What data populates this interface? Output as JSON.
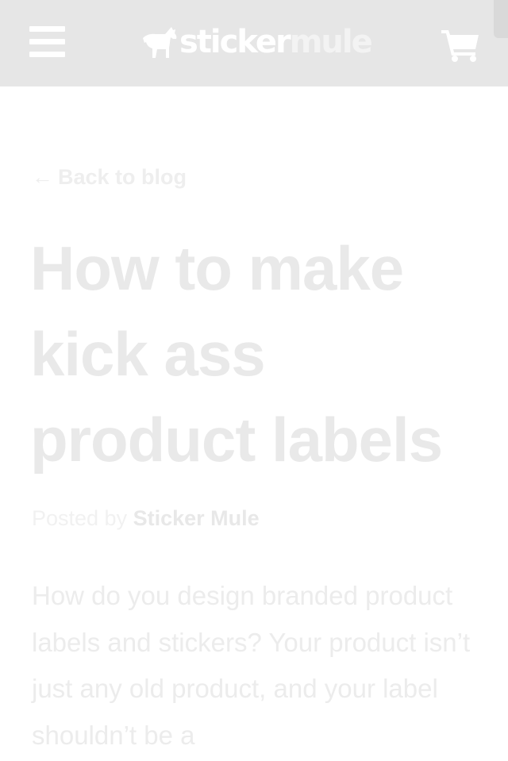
{
  "header": {
    "menu_icon": "hamburger-menu-icon",
    "logo_part1": "sticker",
    "logo_part2": "mule",
    "cart_icon": "shopping-cart-icon",
    "background": "#e6e6e6"
  },
  "article": {
    "back_arrow": "←",
    "back_label": "Back to blog",
    "title": "How to make kick ass product labels",
    "byline_prefix": "Posted by",
    "byline_author": "Sticker Mule",
    "body": "How do you design branded product labels and stickers? Your product isn’t just any old product, and your label shouldn’t be a"
  },
  "colors": {
    "header_bg": "#e6e6e6",
    "page_bg": "#ffffff",
    "faded_text": "#eeeeee"
  }
}
